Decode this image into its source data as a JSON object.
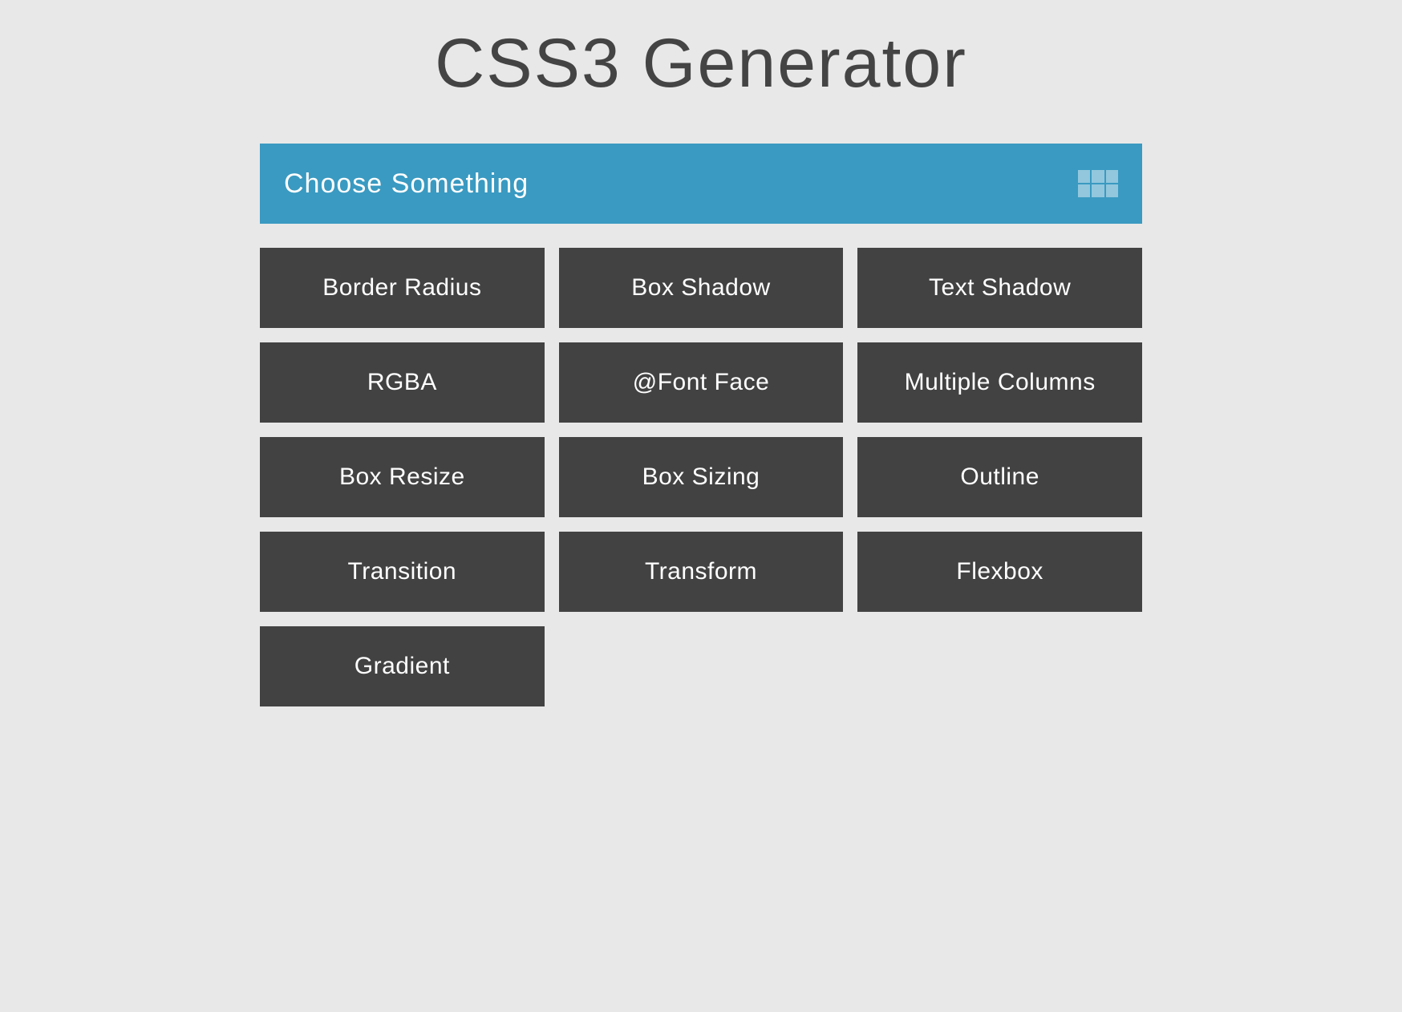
{
  "page": {
    "title": "CSS3 Generator"
  },
  "dropdown": {
    "label": "Choose Something"
  },
  "tiles": [
    {
      "label": "Border Radius",
      "slug": "border-radius"
    },
    {
      "label": "Box Shadow",
      "slug": "box-shadow"
    },
    {
      "label": "Text Shadow",
      "slug": "text-shadow"
    },
    {
      "label": "RGBA",
      "slug": "rgba"
    },
    {
      "label": "@Font Face",
      "slug": "font-face"
    },
    {
      "label": "Multiple Columns",
      "slug": "multiple-columns"
    },
    {
      "label": "Box Resize",
      "slug": "box-resize"
    },
    {
      "label": "Box Sizing",
      "slug": "box-sizing"
    },
    {
      "label": "Outline",
      "slug": "outline"
    },
    {
      "label": "Transition",
      "slug": "transition"
    },
    {
      "label": "Transform",
      "slug": "transform"
    },
    {
      "label": "Flexbox",
      "slug": "flexbox"
    },
    {
      "label": "Gradient",
      "slug": "gradient"
    }
  ],
  "colors": {
    "pageBg": "#e8e8e8",
    "accent": "#3a9ac1",
    "tileBg": "#424242",
    "titleText": "#444444"
  }
}
